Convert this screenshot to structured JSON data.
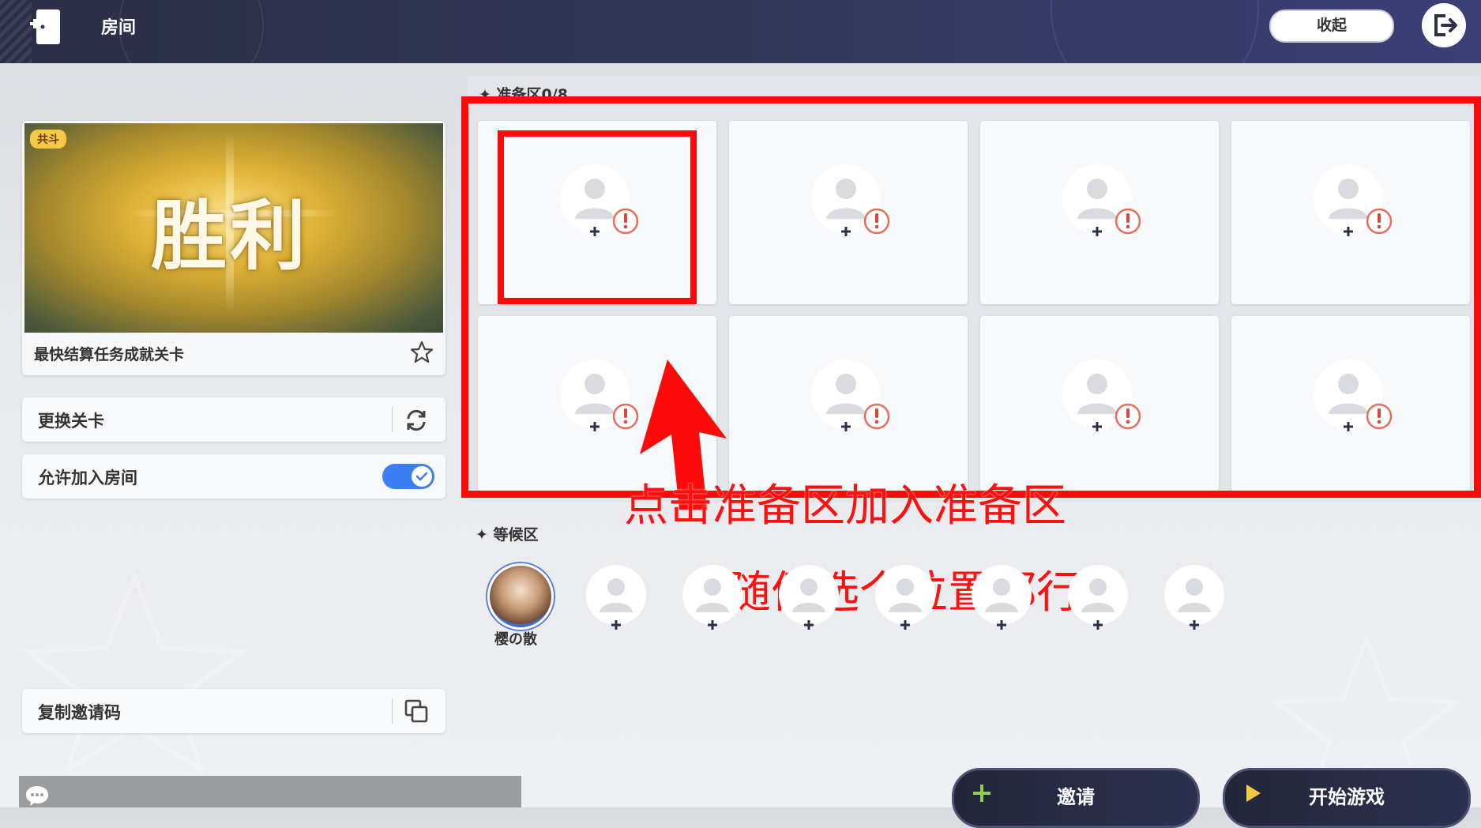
{
  "header": {
    "title": "房间",
    "collapse_label": "收起"
  },
  "level": {
    "badge": "共斗",
    "image_text": "胜利",
    "name": "最快结算任务成就关卡"
  },
  "panel": {
    "change_level_label": "更换关卡",
    "allow_join_label": "允许加入房间",
    "allow_join_enabled": true,
    "copy_invite_label": "复制邀请码"
  },
  "ready_area": {
    "title": "准备区0/8",
    "slots": 8
  },
  "waiting_area": {
    "title": "等候区",
    "player_name": "樱の散",
    "empty_slots": 7
  },
  "annotations": {
    "line1": "点击准备区加入准备区",
    "line2": "随便选个位置都行"
  },
  "buttons": {
    "invite_label": "邀请",
    "start_label": "开始游戏"
  },
  "colors": {
    "accent_blue": "#3b7ef5",
    "annotation_red": "#ff0a0a",
    "badge_yellow": "#f6c945"
  }
}
